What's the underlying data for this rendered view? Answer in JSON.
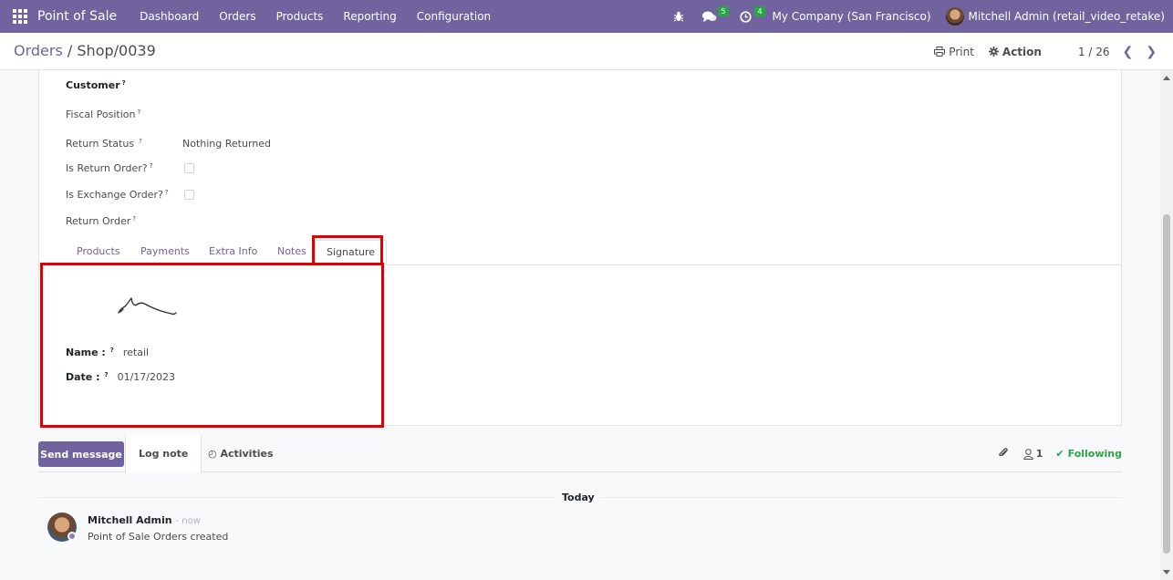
{
  "navbar": {
    "app_name": "Point of Sale",
    "menu": [
      "Dashboard",
      "Orders",
      "Products",
      "Reporting",
      "Configuration"
    ],
    "messages_count": "5",
    "activities_count": "4",
    "company": "My Company (San Francisco)",
    "user": "Mitchell Admin (retail_video_retake)"
  },
  "control_panel": {
    "breadcrumb_parent": "Orders",
    "breadcrumb_sep": "/",
    "breadcrumb_current": "Shop/0039",
    "print_label": "Print",
    "action_label": "Action",
    "pager": "1 / 26"
  },
  "form": {
    "fields": [
      {
        "label": "Customer",
        "help": "?",
        "value": ""
      },
      {
        "label": "Fiscal Position",
        "help": "?",
        "value": ""
      },
      {
        "label": "Return Status",
        "help": "?",
        "value": "Nothing Returned"
      },
      {
        "label": "Is Return Order?",
        "help": "?",
        "checked": false
      },
      {
        "label": "Is Exchange Order?",
        "help": "?",
        "checked": false
      },
      {
        "label": "Return Order",
        "help": "?",
        "value": ""
      }
    ],
    "tabs": [
      "Products",
      "Payments",
      "Extra Info",
      "Notes",
      "Signature"
    ],
    "active_tab": "Signature",
    "signature": {
      "name_label": "Name :",
      "name_help": "?",
      "name_value": "retail",
      "date_label": "Date :",
      "date_help": "?",
      "date_value": "01/17/2023"
    }
  },
  "chatter": {
    "send_message": "Send message",
    "log_note": "Log note",
    "activities": "Activities",
    "followers_count": "1",
    "following": "Following",
    "today": "Today",
    "message": {
      "author": "Mitchell Admin",
      "time": "- now",
      "body": "Point of Sale Orders created"
    }
  },
  "colors": {
    "brand": "#71639e",
    "highlight": "#e00000",
    "following": "#28a745"
  }
}
